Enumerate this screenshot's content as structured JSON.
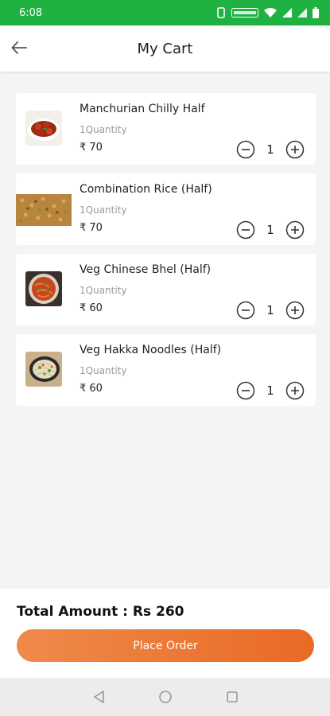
{
  "status_bar": {
    "time": "6:08",
    "icons": [
      "vibrate-icon",
      "volte-icon",
      "wifi-icon",
      "signal-icon",
      "signal-icon",
      "battery-icon"
    ]
  },
  "header": {
    "title": "My Cart",
    "back_icon": "arrow-left-icon"
  },
  "cart": {
    "items": [
      {
        "name": "Manchurian Chilly Half",
        "quantity_label": "1Quantity",
        "price": "₹ 70",
        "count": "1",
        "image": "manchurian-photo"
      },
      {
        "name": "Combination Rice (Half)",
        "quantity_label": "1Quantity",
        "price": "₹ 70",
        "count": "1",
        "image": "fried-rice-photo"
      },
      {
        "name": "Veg Chinese Bhel (Half)",
        "quantity_label": "1Quantity",
        "price": "₹ 60",
        "count": "1",
        "image": "chinese-bhel-photo"
      },
      {
        "name": "Veg Hakka Noodles (Half)",
        "quantity_label": "1Quantity",
        "price": "₹ 60",
        "count": "1",
        "image": "hakka-noodles-photo"
      }
    ],
    "minus_icon": "minus-circle-icon",
    "plus_icon": "plus-circle-icon"
  },
  "footer": {
    "total_label": "Total Amount : Rs 260",
    "place_order_label": "Place Order"
  },
  "colors": {
    "status_bar": "#1fb141",
    "accent_start": "#ee8a4b",
    "accent_end": "#e96a24",
    "background": "#f4f4f4"
  }
}
